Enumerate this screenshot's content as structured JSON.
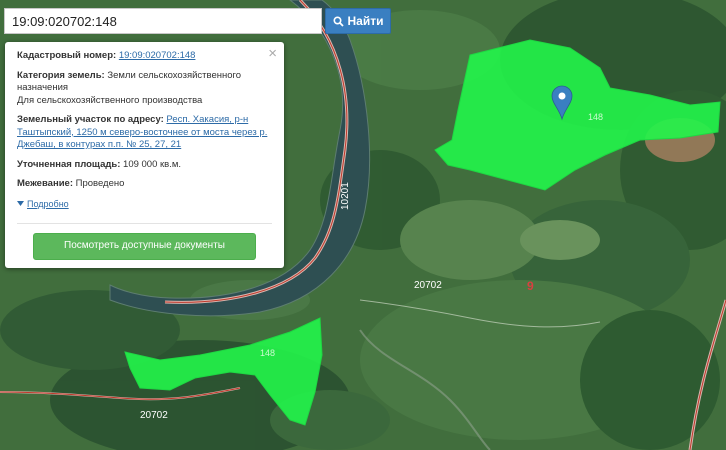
{
  "search": {
    "value": "19:09:020702:148",
    "button_label": "Найти"
  },
  "popup": {
    "close_symbol": "×",
    "cadastral_label": "Кадастровый номер:",
    "cadastral_value": "19:09:020702:148",
    "category_label": "Категория земель:",
    "category_value_1": "Земли сельскохозяйственного назначения",
    "category_value_2": "Для сельскохозяйственного производства",
    "address_label": "Земельный участок по адресу:",
    "address_value": "Респ. Хакасия, р-н Таштыпский, 1250 м северо-восточнее от моста через р. Джебаш, в контурах п.п. № 25, 27, 21",
    "area_label": "Уточненная площадь:",
    "area_value": "109 000 кв.м.",
    "survey_label": "Межевание:",
    "survey_value": "Проведено",
    "more_link": "Подробно",
    "docs_button": "Посмотреть доступные документы"
  },
  "map_labels": {
    "parcel_top": "148",
    "parcel_bottom": "148",
    "road_top": "10201",
    "block_mid": "20702",
    "block_bottom": "20702",
    "number_red": "9"
  },
  "colors": {
    "parcel_fill": "#22f54a",
    "button_blue": "#3a7fc1",
    "button_green": "#5cb85c",
    "marker": "#3a7fc1",
    "road_line": "#c0392b"
  },
  "icons": {
    "search": "search-icon",
    "marker": "map-marker-icon",
    "close": "close-icon",
    "more": "caret-down-icon"
  }
}
